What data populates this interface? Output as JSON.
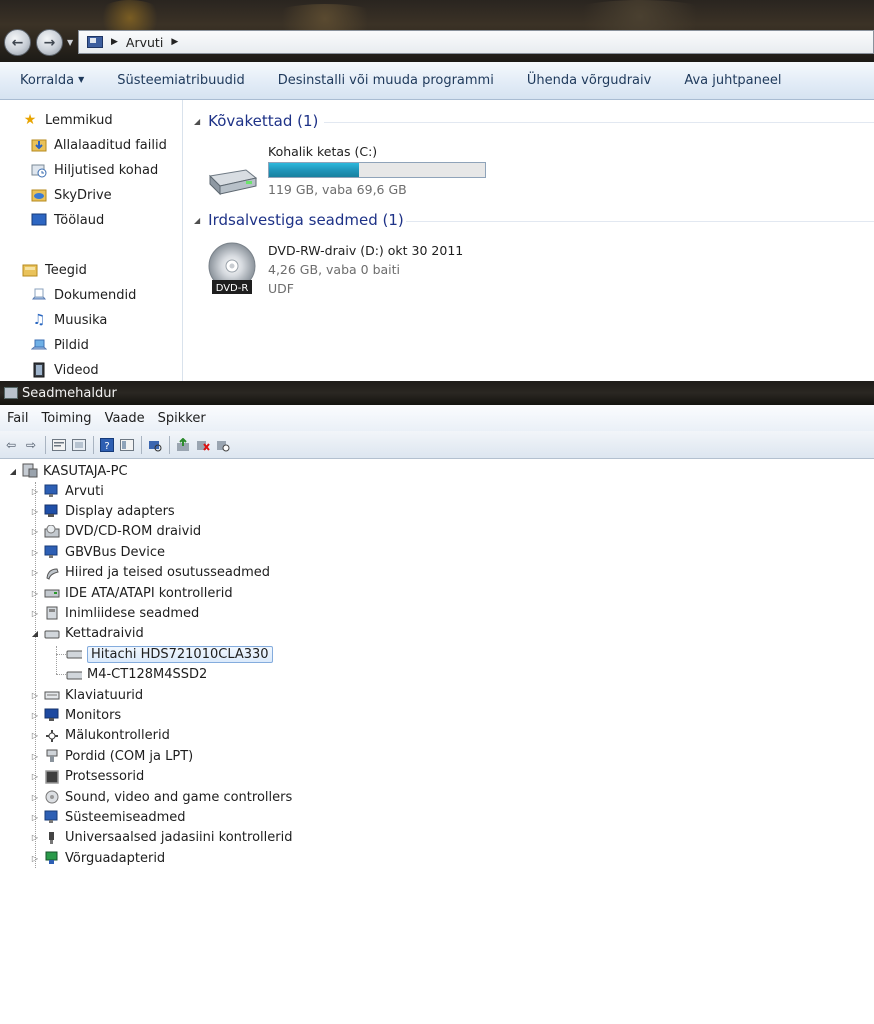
{
  "explorer": {
    "address": {
      "path": [
        "Arvuti"
      ]
    },
    "command_bar": [
      {
        "label": "Korralda",
        "has_dropdown": true
      },
      {
        "label": "Süsteemiatribuudid"
      },
      {
        "label": "Desinstalli või muuda programmi"
      },
      {
        "label": "Ühenda võrgudraiv"
      },
      {
        "label": "Ava juhtpaneel"
      }
    ],
    "nav_pane": {
      "favorites": {
        "label": "Lemmikud",
        "icon": "star-icon"
      },
      "favorite_items": [
        {
          "label": "Allalaaditud failid",
          "icon": "downloads-folder-icon"
        },
        {
          "label": "Hiljutised kohad",
          "icon": "recent-places-icon"
        },
        {
          "label": "SkyDrive",
          "icon": "skydrive-folder-icon"
        },
        {
          "label": "Töölaud",
          "icon": "desktop-icon"
        }
      ],
      "libraries": {
        "label": "Teegid",
        "icon": "libraries-icon"
      },
      "library_items": [
        {
          "label": "Dokumendid",
          "icon": "documents-icon"
        },
        {
          "label": "Muusika",
          "icon": "music-icon"
        },
        {
          "label": "Pildid",
          "icon": "pictures-icon"
        },
        {
          "label": "Videod",
          "icon": "videos-icon"
        }
      ]
    },
    "groups": {
      "hard_drives": {
        "header": "Kõvakettad (1)",
        "drive": {
          "name": "Kohalik ketas (C:)",
          "details": "119 GB, vaba 69,6 GB",
          "used_fraction": 0.415
        }
      },
      "removable": {
        "header": "Irdsalvestiga seadmed (1)",
        "drive": {
          "name": "DVD-RW-draiv (D:) okt 30 2011",
          "details": "4,26 GB, vaba 0 baiti",
          "filesystem": "UDF",
          "disc_label": "DVD-R"
        }
      }
    }
  },
  "device_manager": {
    "title": "Seadmehaldur",
    "menu": [
      "Fail",
      "Toiming",
      "Vaade",
      "Spikker"
    ],
    "toolbar_icons": [
      "back-icon",
      "forward-icon",
      "properties-icon",
      "view-icon",
      "help-icon",
      "view2-icon",
      "scan-icon",
      "update-driver-icon",
      "uninstall-icon",
      "disable-icon"
    ],
    "root": "KASUTAJA-PC",
    "categories": [
      {
        "label": "Arvuti"
      },
      {
        "label": "Display adapters"
      },
      {
        "label": "DVD/CD-ROM draivid"
      },
      {
        "label": "GBVBus Device"
      },
      {
        "label": "Hiired ja teised osutusseadmed"
      },
      {
        "label": "IDE ATA/ATAPI kontrollerid"
      },
      {
        "label": "Inimliidese seadmed"
      },
      {
        "label": "Kettadraivid"
      },
      {
        "label": "Klaviatuurid"
      },
      {
        "label": "Monitors"
      },
      {
        "label": "Mälukontrollerid"
      },
      {
        "label": "Pordid (COM ja LPT)"
      },
      {
        "label": "Protsessorid"
      },
      {
        "label": "Sound, video and game controllers"
      },
      {
        "label": "Süsteemiseadmed"
      },
      {
        "label": "Universaalsed jadasiini kontrollerid"
      },
      {
        "label": "Võrguadapterid"
      }
    ],
    "disk_drives": [
      {
        "label": "Hitachi HDS721010CLA330",
        "selected": true
      },
      {
        "label": "M4-CT128M4SSD2",
        "selected": false
      }
    ]
  }
}
